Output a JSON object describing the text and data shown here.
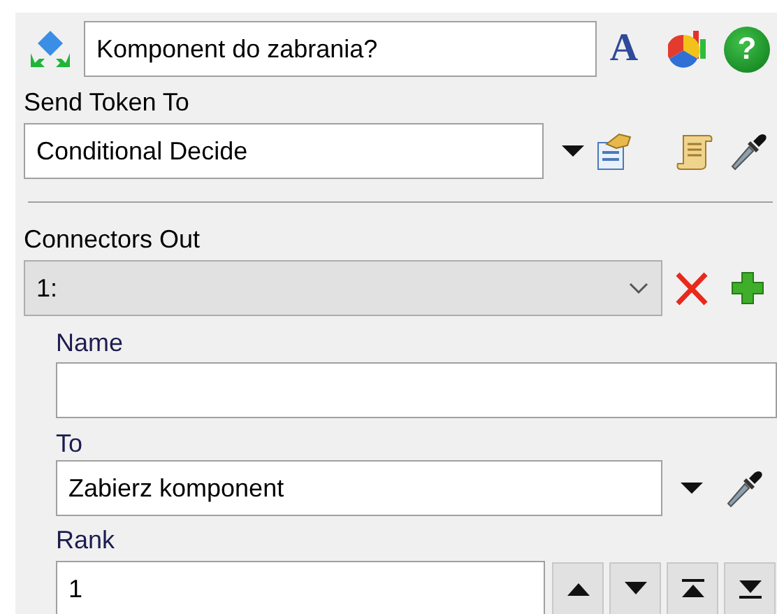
{
  "object_name": {
    "value": "Komponent do zabrania?"
  },
  "font_button": "A",
  "help_button": "?",
  "send_token_to": {
    "label": "Send Token To",
    "value": "Conditional Decide"
  },
  "connectors_out": {
    "label": "Connectors Out",
    "value": "1:"
  },
  "connector": {
    "name": {
      "label": "Name"
    },
    "to": {
      "label": "To",
      "value": "Zabierz komponent"
    },
    "rank": {
      "label": "Rank",
      "value": "1"
    }
  }
}
